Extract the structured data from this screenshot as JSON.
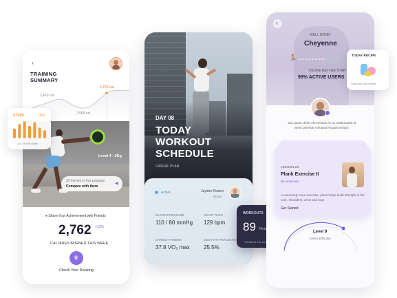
{
  "training": {
    "title_line1": "TRAINING",
    "title_line2": "SUMMARY",
    "cal_high": "2,763 cal",
    "cal_mid": "2,419 cal",
    "cal_low": "2,565 cal",
    "steps_label": "STEPS",
    "steps_change": "+8%",
    "steps_sub": "30,016 this week",
    "steps_bars": [
      0.55,
      0.8,
      0.95,
      0.7,
      0.9,
      0.6,
      0.45
    ],
    "level_text": "Level 4 - 3Kg",
    "friends_text": "32 friends in this program",
    "compare_text": "Compare with them",
    "share_text": "Share Your Achievement with Friends",
    "calories_value": "2,762",
    "calories_change": "+12%",
    "calories_label": "CALORIES BURNED THIS WEEK",
    "ranking_label": "Check Your Ranking"
  },
  "schedule": {
    "day": "DAY 08",
    "title_line1": "TODAY",
    "title_line2": "WORKOUT",
    "title_line3": "SCHEDULE",
    "plan": "CASUAL PLAN",
    "status": "Active",
    "user_name": "Jaydon Rosser",
    "user_age": "62 yrs",
    "bp_label": "BLOOD PRESSURE",
    "bp_value": "110 / 80 mmHg",
    "hr_label": "HEART RATE",
    "hr_value": "129 bpm",
    "cf_label": "CARDIO FITNESS",
    "cf_value": "37.8 VO₂ max",
    "bf_label": "BODY FAT PERCENTAGE",
    "bf_value": "25.5%",
    "workouts_label": "WORKOUTS",
    "workouts_value": "89",
    "workouts_finished": "Finished",
    "workouts_week": "3 finished this week"
  },
  "achievement": {
    "well_done": "WELL DONE!",
    "name": "Cheyenne",
    "better_than": "YOU'RE BETTER THAN",
    "percent_users": "95% ACTIVE USERS",
    "recipe_title": "TODAY RECIPE",
    "recipe_sub": "Saved by 320 trainers",
    "quote": "Dui quam dolor elementum in ut. Malesuada id amet pulvinar volutpat feugiat tempor.",
    "lesson_label": "LESSON 23",
    "lesson_title": "Plank Exercise II",
    "lesson_workouts": "80 workouts",
    "lesson_desc": "A commonly seen exercise, plank helps build strength in the core, shoulders, arms and legs.",
    "get_started": "Get Started",
    "level": "Level 9",
    "difficulty": "Select Difficulty"
  },
  "colors": {
    "accent_purple": "#7b5fe0",
    "orange": "#f29a3c",
    "lime": "#c7f03b",
    "dark": "#1c1c2e"
  }
}
